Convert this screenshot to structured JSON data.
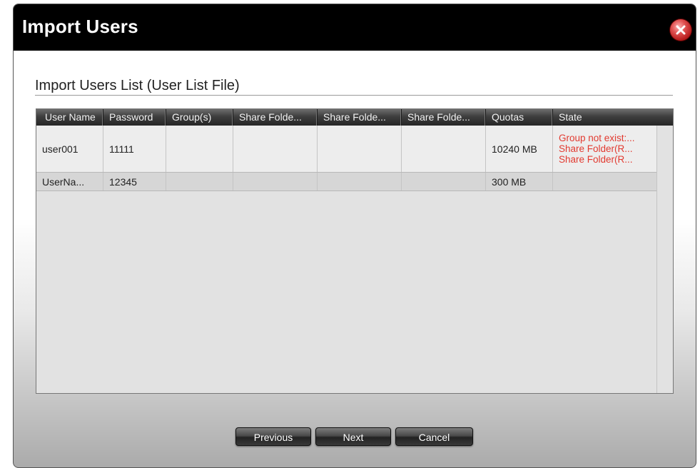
{
  "dialog": {
    "title": "Import Users",
    "section_title": "Import Users List (User List File)"
  },
  "table": {
    "columns": [
      "User Name",
      "Password",
      "Group(s)",
      "Share Folde...",
      "Share Folde...",
      "Share Folde...",
      "Quotas",
      "State"
    ],
    "rows": [
      {
        "user_name": "user001",
        "password": "11111",
        "groups": "",
        "share1": "",
        "share2": "",
        "share3": "",
        "quotas": "10240 MB",
        "state": [
          "Group not exist:...",
          "Share Folder(R...",
          "Share Folder(R..."
        ]
      },
      {
        "user_name": "UserNa...",
        "password": "12345",
        "groups": "",
        "share1": "",
        "share2": "",
        "share3": "",
        "quotas": "300 MB",
        "state": []
      }
    ]
  },
  "buttons": {
    "previous": "Previous",
    "next": "Next",
    "cancel": "Cancel"
  },
  "icons": {
    "close": "close-icon"
  },
  "colors": {
    "title_bar": "#000000",
    "error_text": "#e23a30",
    "close_button": "#c0392b"
  }
}
